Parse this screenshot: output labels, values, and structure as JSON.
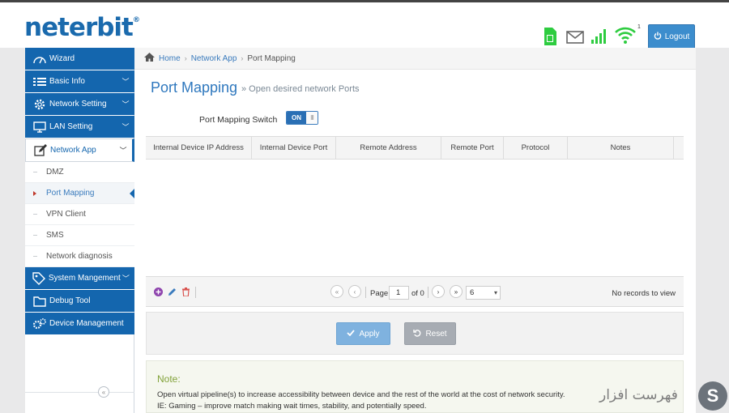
{
  "brand": {
    "logo": "neterbit",
    "logo_mark": "®"
  },
  "header": {
    "logout_label": "Logout",
    "signal_badge": "1",
    "colors": {
      "sim": "#2ecc40",
      "signal": "#2ecc40",
      "logout_bg": "#3c8dcd"
    }
  },
  "sidebar": {
    "items": [
      {
        "label": "Wizard",
        "icon": "gauge-icon"
      },
      {
        "label": "Basic Info",
        "icon": "list-icon"
      },
      {
        "label": "Network Setting",
        "icon": "gear-icon"
      },
      {
        "label": "LAN Setting",
        "icon": "monitor-icon"
      },
      {
        "label": "Network App",
        "icon": "edit-icon"
      },
      {
        "label": "System Mangement",
        "icon": "tag-icon"
      },
      {
        "label": "Debug Tool",
        "icon": "folder-icon"
      },
      {
        "label": "Device Management",
        "icon": "gears-icon"
      }
    ],
    "sub_items": [
      "DMZ",
      "Port Mapping",
      "VPN Client",
      "SMS",
      "Network diagnosis"
    ]
  },
  "breadcrumb": {
    "home": "Home",
    "parent": "Network App",
    "current": "Port Mapping"
  },
  "page": {
    "title": "Port Mapping",
    "subtitle": "» Open desired network Ports",
    "switch_label": "Port Mapping Switch",
    "switch_state": "ON",
    "switch_handle": "III"
  },
  "grid": {
    "columns": [
      "Internal Device IP Address",
      "Internal Device Port",
      "Remote Address",
      "Remote Port",
      "Protocol",
      "Notes"
    ],
    "rows": []
  },
  "pager": {
    "page_label": "Page",
    "page_value": "1",
    "of_label": "of 0",
    "rows_per_page": "6",
    "no_records": "No records to view"
  },
  "buttons": {
    "apply": "Apply",
    "reset": "Reset"
  },
  "note": {
    "title": "Note:",
    "line1": "Open virtual pipeline(s) to increase accessibility between device and the rest of the world at the cost of network security.",
    "line2": "IE: Gaming – improve match making wait times, stability, and potentially speed."
  },
  "watermark": {
    "text": "فهرست افزار"
  }
}
